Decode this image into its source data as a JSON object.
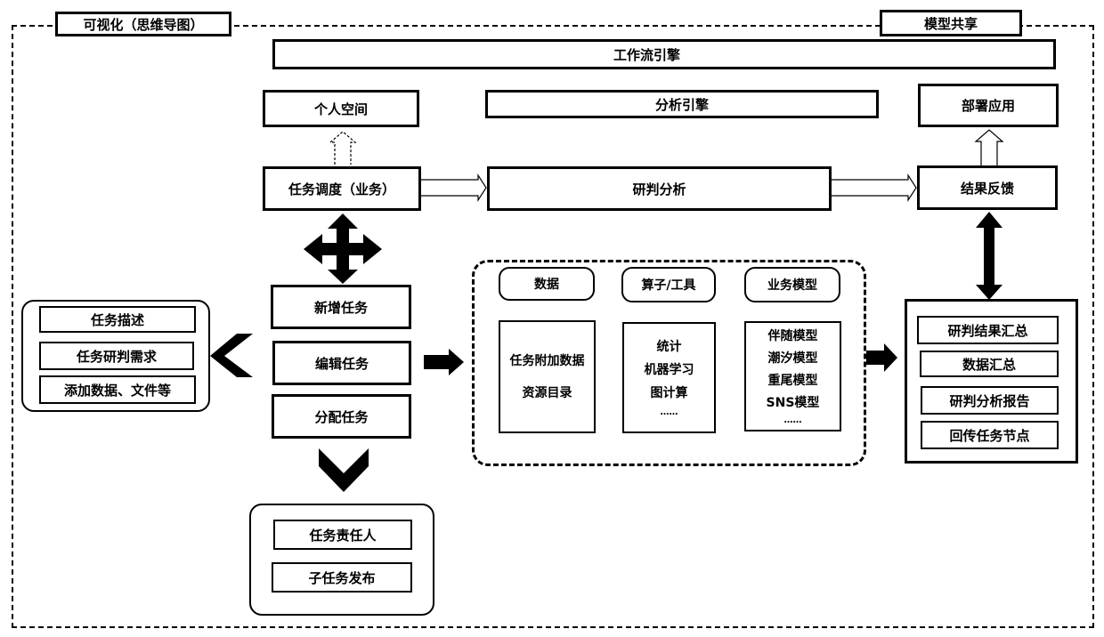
{
  "frame": {
    "visualization_label": "可视化（思维导图）",
    "model_share_label": "模型共享"
  },
  "engines": {
    "workflow_engine": "工作流引擎",
    "analysis_engine": "分析引擎"
  },
  "top_row": {
    "personal_space": "个人空间",
    "deploy_app": "部署应用"
  },
  "middle_row": {
    "task_dispatch": "任务调度（业务）",
    "analysis_judgement": "研判分析",
    "result_feedback": "结果反馈"
  },
  "task_actions": [
    "新增任务",
    "编辑任务",
    "分配任务"
  ],
  "task_details": [
    "任务描述",
    "任务研判需求",
    "添加数据、文件等"
  ],
  "assignment": [
    "任务责任人",
    "子任务发布"
  ],
  "resources": {
    "columns": [
      {
        "header": "数据",
        "items": [
          "任务附加数据",
          "资源目录"
        ]
      },
      {
        "header": "算子/工具",
        "items": [
          "统计",
          "机器学习",
          "图计算",
          "……"
        ]
      },
      {
        "header": "业务模型",
        "items": [
          "伴随模型",
          "潮汐模型",
          "重尾模型",
          "SNS模型",
          "……"
        ]
      }
    ]
  },
  "results": [
    "研判结果汇总",
    "数据汇总",
    "研判分析报告",
    "回传任务节点"
  ]
}
